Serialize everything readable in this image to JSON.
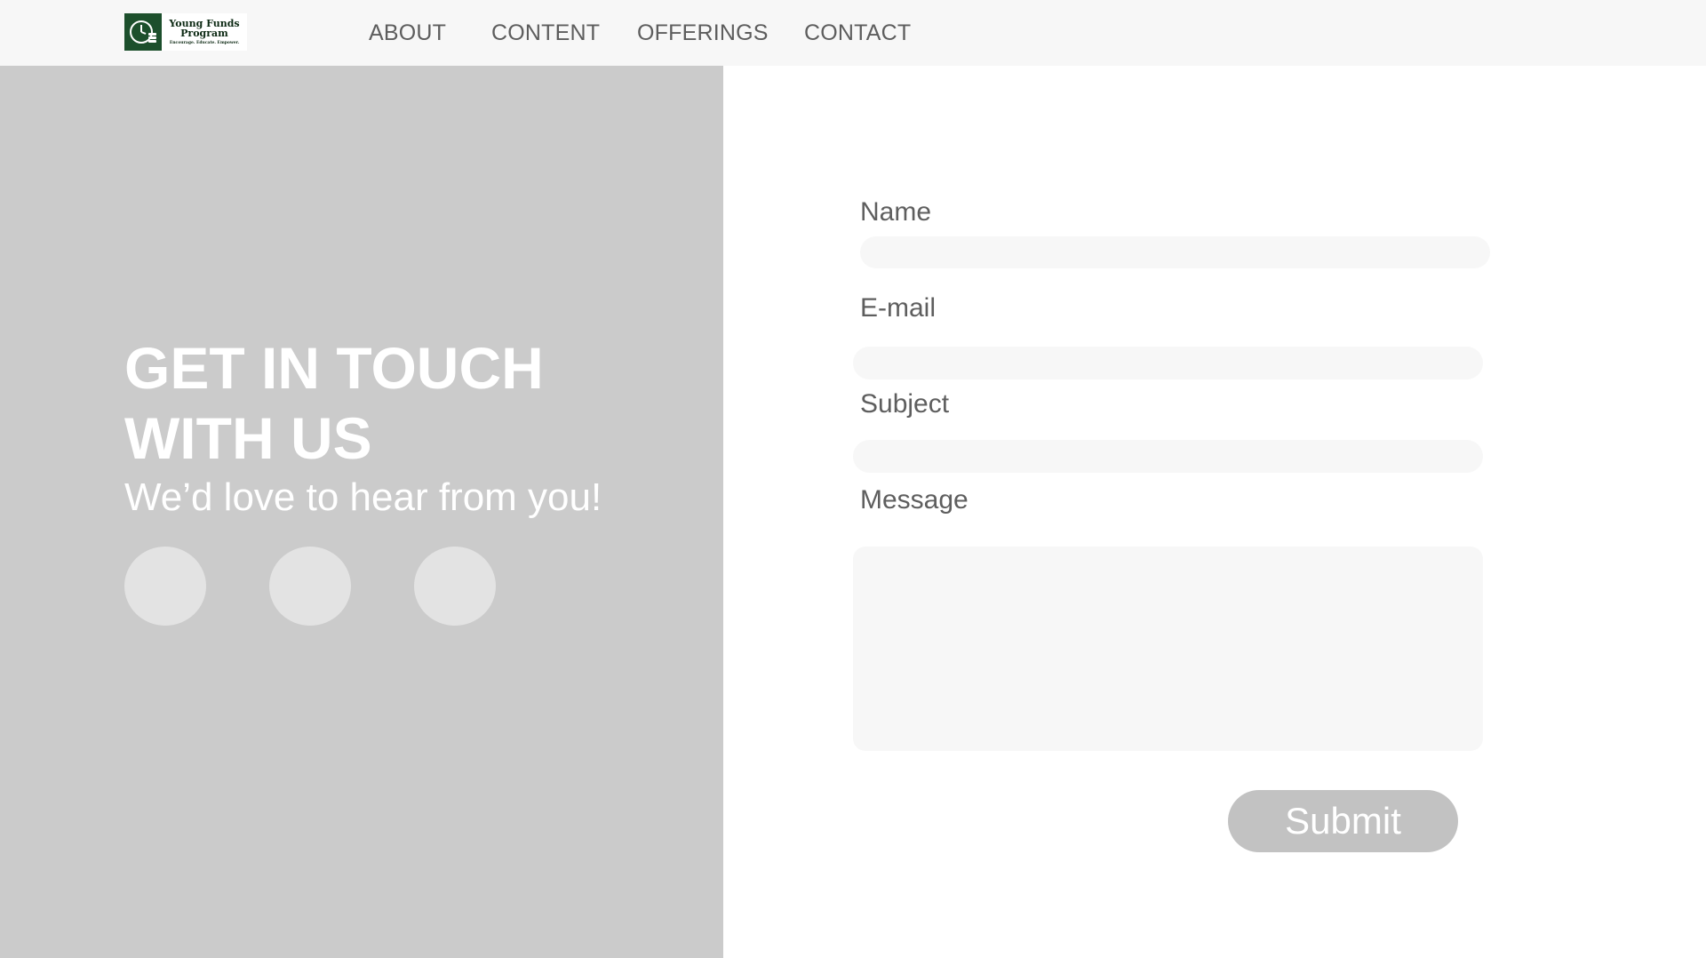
{
  "brand": {
    "line1": "Young Funds",
    "line2": "Program",
    "tagline": "Encourage. Educate. Empower.",
    "logo_icon": "clock-coins-icon",
    "color": "#1c4f2c"
  },
  "nav": {
    "items": [
      "ABOUT",
      "CONTENT",
      "OFFERINGS",
      "CONTACT"
    ]
  },
  "hero": {
    "title_line1": "GET IN TOUCH",
    "title_line2": "WITH US",
    "subtitle": "We’d love to hear from you!"
  },
  "social": [
    "social-icon-1",
    "social-icon-2",
    "social-icon-3"
  ],
  "form": {
    "name_label": "Name",
    "email_label": "E-mail",
    "subject_label": "Subject",
    "message_label": "Message",
    "name_value": "",
    "email_value": "",
    "subject_value": "",
    "message_value": "",
    "submit_label": "Submit"
  },
  "colors": {
    "panel": "#cbcbcb",
    "field": "#f7f7f7",
    "button": "#c2c2c2",
    "text": "#5e5e5e"
  }
}
